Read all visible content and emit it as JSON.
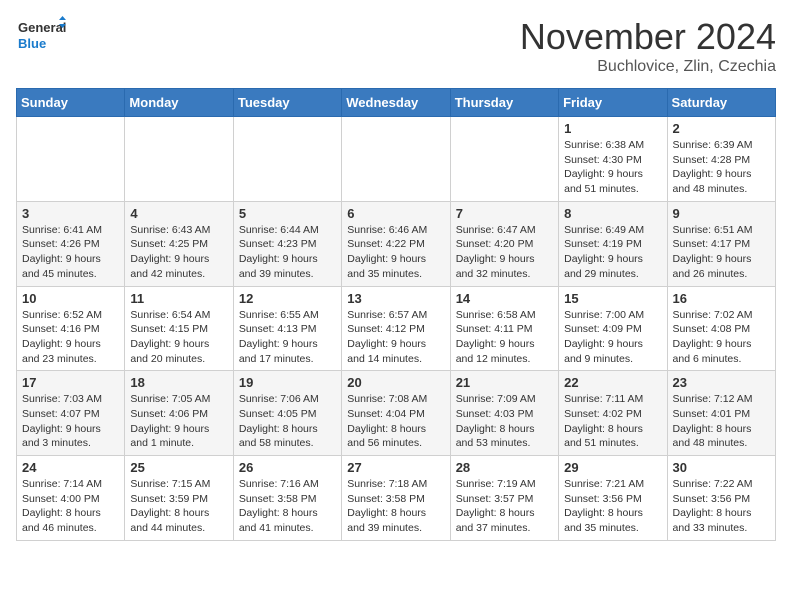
{
  "header": {
    "logo_general": "General",
    "logo_blue": "Blue",
    "month": "November 2024",
    "location": "Buchlovice, Zlin, Czechia"
  },
  "days_of_week": [
    "Sunday",
    "Monday",
    "Tuesday",
    "Wednesday",
    "Thursday",
    "Friday",
    "Saturday"
  ],
  "weeks": [
    [
      {
        "day": "",
        "info": ""
      },
      {
        "day": "",
        "info": ""
      },
      {
        "day": "",
        "info": ""
      },
      {
        "day": "",
        "info": ""
      },
      {
        "day": "",
        "info": ""
      },
      {
        "day": "1",
        "info": "Sunrise: 6:38 AM\nSunset: 4:30 PM\nDaylight: 9 hours and 51 minutes."
      },
      {
        "day": "2",
        "info": "Sunrise: 6:39 AM\nSunset: 4:28 PM\nDaylight: 9 hours and 48 minutes."
      }
    ],
    [
      {
        "day": "3",
        "info": "Sunrise: 6:41 AM\nSunset: 4:26 PM\nDaylight: 9 hours and 45 minutes."
      },
      {
        "day": "4",
        "info": "Sunrise: 6:43 AM\nSunset: 4:25 PM\nDaylight: 9 hours and 42 minutes."
      },
      {
        "day": "5",
        "info": "Sunrise: 6:44 AM\nSunset: 4:23 PM\nDaylight: 9 hours and 39 minutes."
      },
      {
        "day": "6",
        "info": "Sunrise: 6:46 AM\nSunset: 4:22 PM\nDaylight: 9 hours and 35 minutes."
      },
      {
        "day": "7",
        "info": "Sunrise: 6:47 AM\nSunset: 4:20 PM\nDaylight: 9 hours and 32 minutes."
      },
      {
        "day": "8",
        "info": "Sunrise: 6:49 AM\nSunset: 4:19 PM\nDaylight: 9 hours and 29 minutes."
      },
      {
        "day": "9",
        "info": "Sunrise: 6:51 AM\nSunset: 4:17 PM\nDaylight: 9 hours and 26 minutes."
      }
    ],
    [
      {
        "day": "10",
        "info": "Sunrise: 6:52 AM\nSunset: 4:16 PM\nDaylight: 9 hours and 23 minutes."
      },
      {
        "day": "11",
        "info": "Sunrise: 6:54 AM\nSunset: 4:15 PM\nDaylight: 9 hours and 20 minutes."
      },
      {
        "day": "12",
        "info": "Sunrise: 6:55 AM\nSunset: 4:13 PM\nDaylight: 9 hours and 17 minutes."
      },
      {
        "day": "13",
        "info": "Sunrise: 6:57 AM\nSunset: 4:12 PM\nDaylight: 9 hours and 14 minutes."
      },
      {
        "day": "14",
        "info": "Sunrise: 6:58 AM\nSunset: 4:11 PM\nDaylight: 9 hours and 12 minutes."
      },
      {
        "day": "15",
        "info": "Sunrise: 7:00 AM\nSunset: 4:09 PM\nDaylight: 9 hours and 9 minutes."
      },
      {
        "day": "16",
        "info": "Sunrise: 7:02 AM\nSunset: 4:08 PM\nDaylight: 9 hours and 6 minutes."
      }
    ],
    [
      {
        "day": "17",
        "info": "Sunrise: 7:03 AM\nSunset: 4:07 PM\nDaylight: 9 hours and 3 minutes."
      },
      {
        "day": "18",
        "info": "Sunrise: 7:05 AM\nSunset: 4:06 PM\nDaylight: 9 hours and 1 minute."
      },
      {
        "day": "19",
        "info": "Sunrise: 7:06 AM\nSunset: 4:05 PM\nDaylight: 8 hours and 58 minutes."
      },
      {
        "day": "20",
        "info": "Sunrise: 7:08 AM\nSunset: 4:04 PM\nDaylight: 8 hours and 56 minutes."
      },
      {
        "day": "21",
        "info": "Sunrise: 7:09 AM\nSunset: 4:03 PM\nDaylight: 8 hours and 53 minutes."
      },
      {
        "day": "22",
        "info": "Sunrise: 7:11 AM\nSunset: 4:02 PM\nDaylight: 8 hours and 51 minutes."
      },
      {
        "day": "23",
        "info": "Sunrise: 7:12 AM\nSunset: 4:01 PM\nDaylight: 8 hours and 48 minutes."
      }
    ],
    [
      {
        "day": "24",
        "info": "Sunrise: 7:14 AM\nSunset: 4:00 PM\nDaylight: 8 hours and 46 minutes."
      },
      {
        "day": "25",
        "info": "Sunrise: 7:15 AM\nSunset: 3:59 PM\nDaylight: 8 hours and 44 minutes."
      },
      {
        "day": "26",
        "info": "Sunrise: 7:16 AM\nSunset: 3:58 PM\nDaylight: 8 hours and 41 minutes."
      },
      {
        "day": "27",
        "info": "Sunrise: 7:18 AM\nSunset: 3:58 PM\nDaylight: 8 hours and 39 minutes."
      },
      {
        "day": "28",
        "info": "Sunrise: 7:19 AM\nSunset: 3:57 PM\nDaylight: 8 hours and 37 minutes."
      },
      {
        "day": "29",
        "info": "Sunrise: 7:21 AM\nSunset: 3:56 PM\nDaylight: 8 hours and 35 minutes."
      },
      {
        "day": "30",
        "info": "Sunrise: 7:22 AM\nSunset: 3:56 PM\nDaylight: 8 hours and 33 minutes."
      }
    ]
  ]
}
